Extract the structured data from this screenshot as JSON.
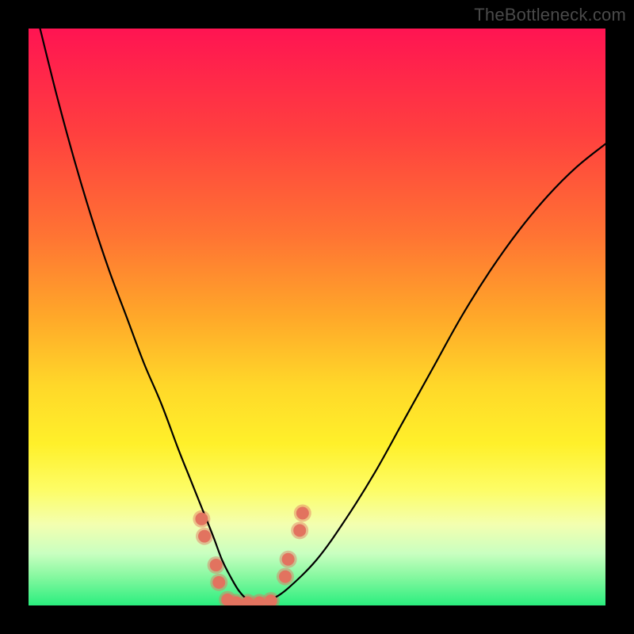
{
  "watermark": "TheBottleneck.com",
  "chart_data": {
    "type": "line",
    "title": "",
    "xlabel": "",
    "ylabel": "",
    "xlim": [
      0,
      100
    ],
    "ylim": [
      0,
      100
    ],
    "series": [
      {
        "name": "bottleneck-curve",
        "x": [
          2,
          5,
          8,
          11,
          14,
          17,
          20,
          23,
          26,
          28,
          30,
          32,
          33.5,
          35,
          36.5,
          38,
          40,
          42,
          45,
          50,
          55,
          60,
          65,
          70,
          75,
          80,
          85,
          90,
          95,
          100
        ],
        "values": [
          100,
          88,
          77,
          67,
          58,
          50,
          42,
          35,
          27,
          22,
          17,
          12,
          8,
          5,
          2.5,
          1,
          0.2,
          1,
          3,
          8,
          15,
          23,
          32,
          41,
          50,
          58,
          65,
          71,
          76,
          80
        ]
      }
    ],
    "markers": {
      "name": "highlight-region",
      "color": "#e2735f",
      "points": [
        {
          "x": 30,
          "y": 15
        },
        {
          "x": 30.5,
          "y": 12
        },
        {
          "x": 32.5,
          "y": 7
        },
        {
          "x": 33,
          "y": 4
        },
        {
          "x": 34.5,
          "y": 1
        },
        {
          "x": 36,
          "y": 0.5
        },
        {
          "x": 38,
          "y": 0.5
        },
        {
          "x": 40,
          "y": 0.5
        },
        {
          "x": 42,
          "y": 0.8
        },
        {
          "x": 44.5,
          "y": 5
        },
        {
          "x": 45,
          "y": 8
        },
        {
          "x": 47,
          "y": 13
        },
        {
          "x": 47.5,
          "y": 16
        }
      ]
    },
    "background_gradient": {
      "top": "#ff1452",
      "upper_mid": "#ffa829",
      "mid": "#fff02a",
      "bottom": "#2aee7e"
    }
  }
}
